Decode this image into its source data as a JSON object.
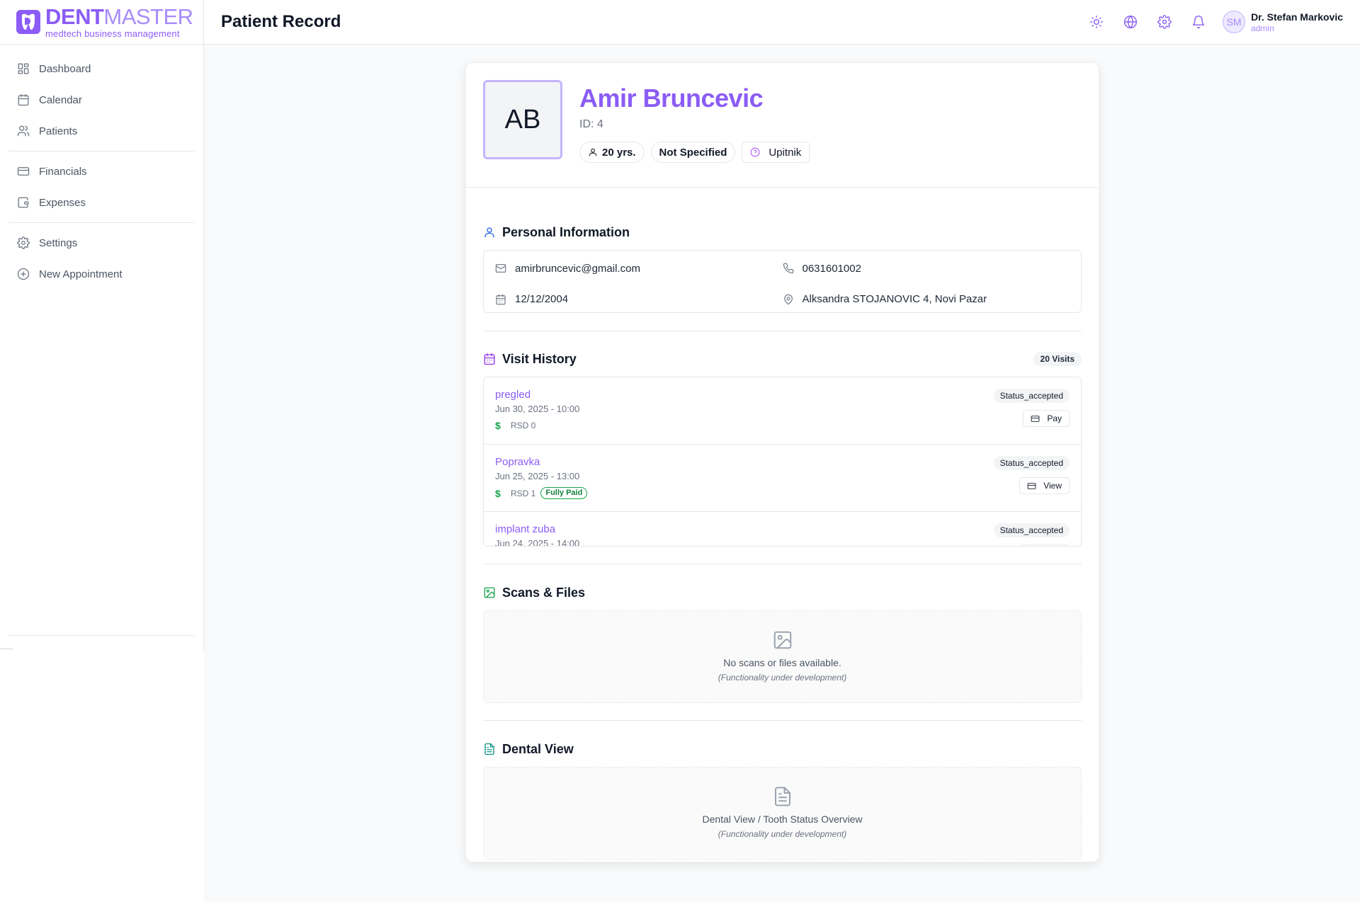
{
  "brand": {
    "name_bold": "DENT",
    "name_light": "MASTER",
    "tagline": "medtech business management"
  },
  "sidebar": {
    "items": [
      {
        "label": "Dashboard",
        "icon": "dashboard-icon"
      },
      {
        "label": "Calendar",
        "icon": "calendar-icon"
      },
      {
        "label": "Patients",
        "icon": "users-icon"
      },
      {
        "label": "Financials",
        "icon": "credit-card-icon"
      },
      {
        "label": "Expenses",
        "icon": "wallet-icon"
      },
      {
        "label": "Settings",
        "icon": "gear-icon"
      },
      {
        "label": "New Appointment",
        "icon": "plus-circle-icon"
      }
    ]
  },
  "header": {
    "title": "Patient Record",
    "icons": [
      "sun-icon",
      "globe-icon",
      "gear-icon",
      "bell-icon"
    ],
    "user": {
      "initials": "SM",
      "name": "Dr. Stefan Markovic",
      "role": "admin"
    }
  },
  "patient": {
    "initials": "AB",
    "name": "Amir Bruncevic",
    "id_label": "ID: 4",
    "age": "20 yrs.",
    "gender": "Not Specified",
    "questionnaire": "Upitnik"
  },
  "personal": {
    "title": "Personal Information",
    "email": "amirbruncevic@gmail.com",
    "phone": "0631601002",
    "dob": "12/12/2004",
    "address": "Alksandra STOJANOVIC 4, Novi Pazar"
  },
  "visits": {
    "title": "Visit History",
    "count_label": "20 Visits",
    "items": [
      {
        "title": "pregled",
        "date": "Jun 30, 2025 - 10:00",
        "price": "RSD 0",
        "paid": "",
        "status": "Status_accepted",
        "action": "Pay"
      },
      {
        "title": "Popravka",
        "date": "Jun 25, 2025 - 13:00",
        "price": "RSD 1",
        "paid": "Fully Paid",
        "status": "Status_accepted",
        "action": "View"
      },
      {
        "title": "implant zuba",
        "date": "Jun 24, 2025 - 14:00",
        "price": "",
        "paid": "",
        "status": "Status_accepted",
        "action": ""
      }
    ]
  },
  "scans": {
    "title": "Scans & Files",
    "message": "No scans or files available.",
    "note": "(Functionality under development)"
  },
  "dental": {
    "title": "Dental View",
    "message": "Dental View / Tooth Status Overview",
    "note": "(Functionality under development)"
  },
  "colors": {
    "accent": "#8b5cf6",
    "success": "#16a34a",
    "info": "#2563eb",
    "teal": "#0d9488"
  }
}
